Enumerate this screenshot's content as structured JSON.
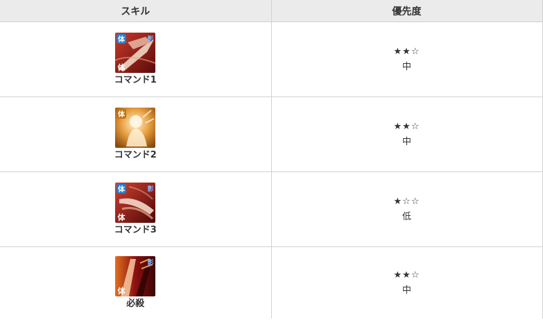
{
  "header": {
    "skill_label": "スキル",
    "priority_label": "優先度"
  },
  "rows": [
    {
      "name": "コマンド1",
      "stars": "★★☆",
      "level": "中",
      "icon": "skill-icon-command-1"
    },
    {
      "name": "コマンド2",
      "stars": "★★☆",
      "level": "中",
      "icon": "skill-icon-command-2"
    },
    {
      "name": "コマンド3",
      "stars": "★☆☆",
      "level": "低",
      "icon": "skill-icon-command-3"
    },
    {
      "name": "必殺",
      "stars": "★★☆",
      "level": "中",
      "icon": "skill-icon-special"
    }
  ],
  "icon_badges": {
    "tai": "体",
    "kage": "影"
  },
  "colors": {
    "header_bg": "#ebebeb",
    "border": "#d2d2d2",
    "icon_red": "#9a1414",
    "icon_orange": "#c27316",
    "badge_blue": "#1f7fd0"
  }
}
